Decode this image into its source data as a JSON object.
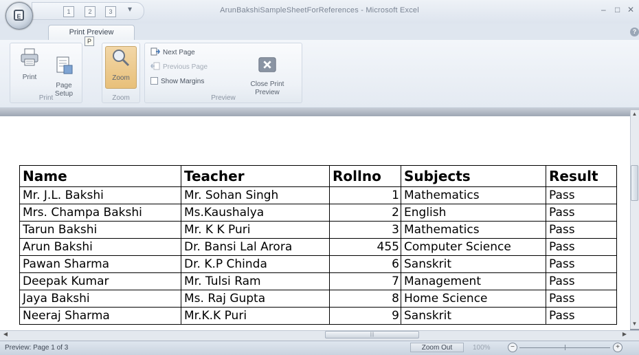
{
  "window": {
    "title": "ArunBakshiSampleSheetForReferences - Microsoft Excel",
    "office_button_glyph": "E",
    "qat_keytips": [
      "1",
      "2",
      "3"
    ],
    "controls": [
      "–",
      "□",
      "✕"
    ]
  },
  "ribbon": {
    "tab": "Print Preview",
    "tab_keytip": "P",
    "groups": {
      "print": {
        "label": "Print",
        "print_label": "Print",
        "page_setup_label": "Page\nSetup"
      },
      "zoom": {
        "label": "Zoom",
        "zoom_label": "Zoom"
      },
      "preview": {
        "label": "Preview",
        "next_page": "Next Page",
        "previous_page": "Previous Page",
        "show_margins": "Show Margins",
        "close_preview": "Close Print\nPreview"
      }
    }
  },
  "table": {
    "headers": [
      "Name",
      "Teacher",
      "Rollno",
      "Subjects",
      "Result"
    ],
    "rows": [
      [
        "Mr. J.L. Bakshi",
        "Mr. Sohan Singh",
        "1",
        "Mathematics",
        "Pass"
      ],
      [
        "Mrs. Champa Bakshi",
        "Ms.Kaushalya",
        "2",
        "English",
        "Pass"
      ],
      [
        "Tarun Bakshi",
        "Mr. K K Puri",
        "3",
        "Mathematics",
        "Pass"
      ],
      [
        "Arun Bakshi",
        "Dr. Bansi Lal Arora",
        "455",
        "Computer Science",
        "Pass"
      ],
      [
        "Pawan Sharma",
        "Dr. K.P Chinda",
        "6",
        "Sanskrit",
        "Pass"
      ],
      [
        "Deepak Kumar",
        "Mr. Tulsi Ram",
        "7",
        "Management",
        "Pass"
      ],
      [
        "Jaya Bakshi",
        "Ms. Raj Gupta",
        "8",
        "Home Science",
        "Pass"
      ],
      [
        "Neeraj Sharma",
        "Mr.K.K Puri",
        "9",
        "Sanskrit",
        "Pass"
      ]
    ]
  },
  "status": {
    "text": "Preview: Page 1 of 3",
    "zoom_out": "Zoom Out",
    "zoom_percent": "100%"
  },
  "colors": {
    "ribbon_bg": "#e4eaf2",
    "active_button": "#e8c07a",
    "sheet_bg": "#8f98a6"
  }
}
